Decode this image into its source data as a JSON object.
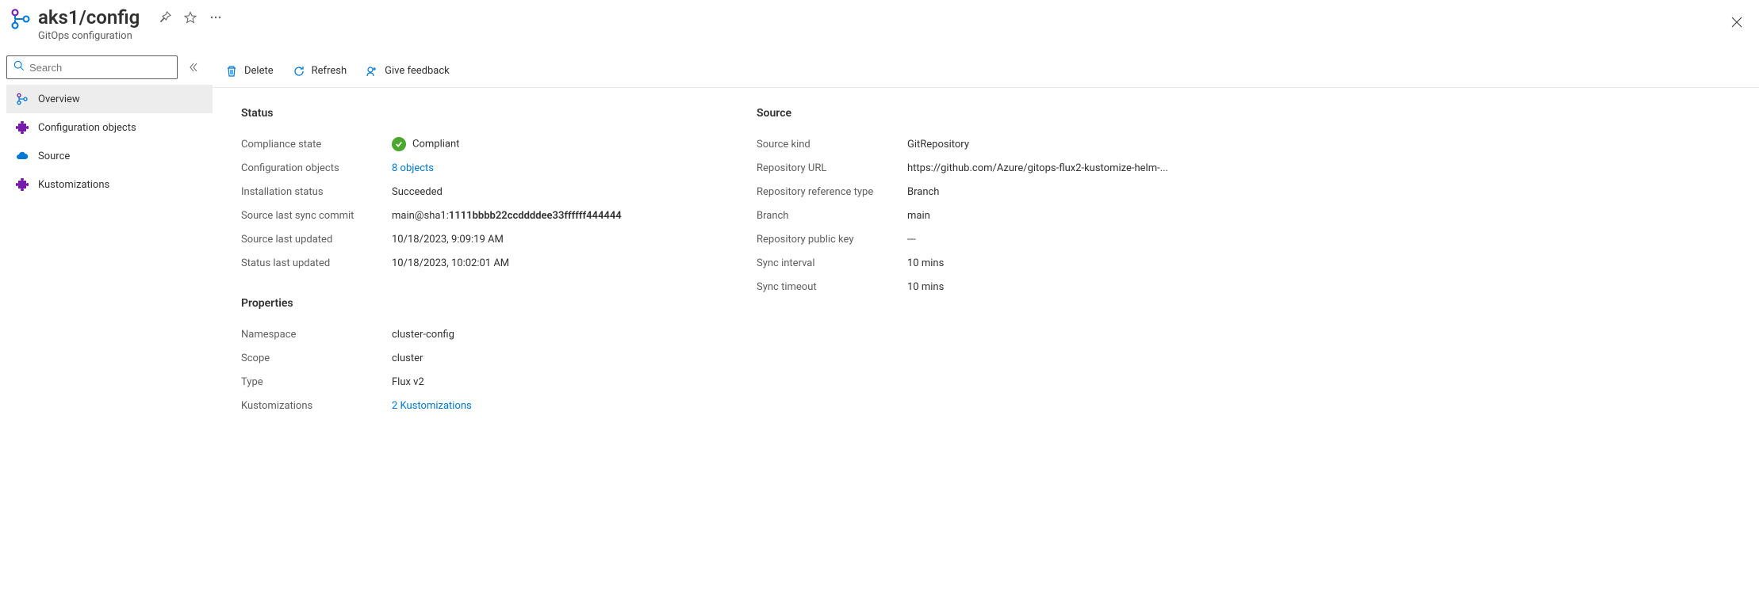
{
  "header": {
    "title": "aks1/config",
    "subtitle": "GitOps configuration"
  },
  "search": {
    "placeholder": "Search"
  },
  "sidebar": {
    "items": [
      {
        "label": "Overview"
      },
      {
        "label": "Configuration objects"
      },
      {
        "label": "Source"
      },
      {
        "label": "Kustomizations"
      }
    ]
  },
  "toolbar": {
    "delete_label": "Delete",
    "refresh_label": "Refresh",
    "feedback_label": "Give feedback"
  },
  "status": {
    "heading": "Status",
    "compliance_label": "Compliance state",
    "compliance_value": "Compliant",
    "config_objects_label": "Configuration objects",
    "config_objects_value": "8 objects",
    "install_status_label": "Installation status",
    "install_status_value": "Succeeded",
    "last_sync_commit_label": "Source last sync commit",
    "last_sync_commit_prefix": "main@sha1:",
    "last_sync_commit_sha": "1111bbbb22ccddddee33ffffff444444",
    "source_last_updated_label": "Source last updated",
    "source_last_updated_value": "10/18/2023, 9:09:19 AM",
    "status_last_updated_label": "Status last updated",
    "status_last_updated_value": "10/18/2023, 10:02:01 AM"
  },
  "properties": {
    "heading": "Properties",
    "namespace_label": "Namespace",
    "namespace_value": "cluster-config",
    "scope_label": "Scope",
    "scope_value": "cluster",
    "type_label": "Type",
    "type_value": "Flux v2",
    "kustomizations_label": "Kustomizations",
    "kustomizations_value": "2 Kustomizations"
  },
  "source": {
    "heading": "Source",
    "kind_label": "Source kind",
    "kind_value": "GitRepository",
    "repo_url_label": "Repository URL",
    "repo_url_value": "https://github.com/Azure/gitops-flux2-kustomize-helm-...",
    "ref_type_label": "Repository reference type",
    "ref_type_value": "Branch",
    "branch_label": "Branch",
    "branch_value": "main",
    "pubkey_label": "Repository public key",
    "pubkey_value": "---",
    "sync_interval_label": "Sync interval",
    "sync_interval_value": "10 mins",
    "sync_timeout_label": "Sync timeout",
    "sync_timeout_value": "10 mins"
  }
}
